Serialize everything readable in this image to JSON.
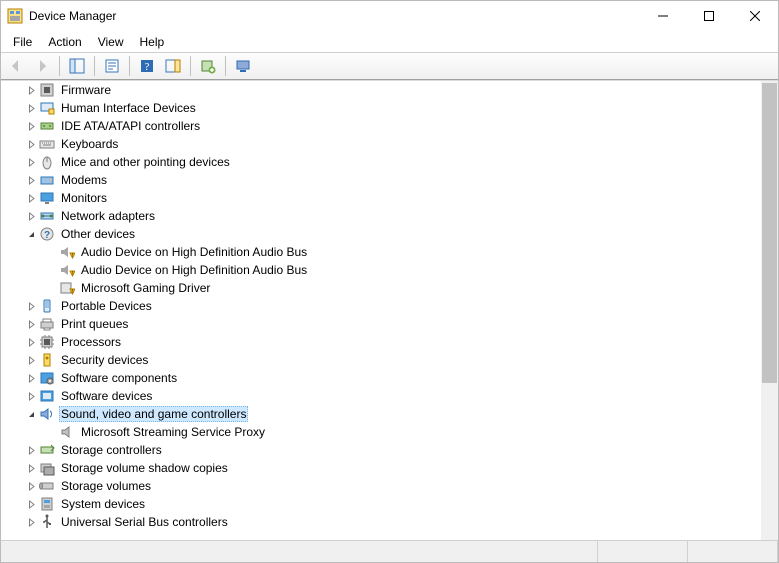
{
  "window": {
    "title": "Device Manager"
  },
  "menu": {
    "file": "File",
    "action": "Action",
    "view": "View",
    "help": "Help"
  },
  "tree": [
    {
      "label": "Firmware",
      "icon": "firmware",
      "expandable": true,
      "expanded": false,
      "children": []
    },
    {
      "label": "Human Interface Devices",
      "icon": "hid",
      "expandable": true,
      "expanded": false,
      "children": []
    },
    {
      "label": "IDE ATA/ATAPI controllers",
      "icon": "ide",
      "expandable": true,
      "expanded": false,
      "children": []
    },
    {
      "label": "Keyboards",
      "icon": "keyboard",
      "expandable": true,
      "expanded": false,
      "children": []
    },
    {
      "label": "Mice and other pointing devices",
      "icon": "mouse",
      "expandable": true,
      "expanded": false,
      "children": []
    },
    {
      "label": "Modems",
      "icon": "modem",
      "expandable": true,
      "expanded": false,
      "children": []
    },
    {
      "label": "Monitors",
      "icon": "monitor",
      "expandable": true,
      "expanded": false,
      "children": []
    },
    {
      "label": "Network adapters",
      "icon": "net",
      "expandable": true,
      "expanded": false,
      "children": []
    },
    {
      "label": "Other devices",
      "icon": "other",
      "expandable": true,
      "expanded": true,
      "children": [
        {
          "label": "Audio Device on High Definition Audio Bus",
          "icon": "audio-warn"
        },
        {
          "label": "Audio Device on High Definition Audio Bus",
          "icon": "audio-warn"
        },
        {
          "label": "Microsoft Gaming Driver",
          "icon": "generic-warn"
        }
      ]
    },
    {
      "label": "Portable Devices",
      "icon": "portable",
      "expandable": true,
      "expanded": false,
      "children": []
    },
    {
      "label": "Print queues",
      "icon": "printer",
      "expandable": true,
      "expanded": false,
      "children": []
    },
    {
      "label": "Processors",
      "icon": "cpu",
      "expandable": true,
      "expanded": false,
      "children": []
    },
    {
      "label": "Security devices",
      "icon": "security",
      "expandable": true,
      "expanded": false,
      "children": []
    },
    {
      "label": "Software components",
      "icon": "swcomp",
      "expandable": true,
      "expanded": false,
      "children": []
    },
    {
      "label": "Software devices",
      "icon": "swdev",
      "expandable": true,
      "expanded": false,
      "children": []
    },
    {
      "label": "Sound, video and game controllers",
      "icon": "sound",
      "expandable": true,
      "expanded": true,
      "selected": true,
      "children": [
        {
          "label": "Microsoft Streaming Service Proxy",
          "icon": "speaker"
        }
      ]
    },
    {
      "label": "Storage controllers",
      "icon": "storagectl",
      "expandable": true,
      "expanded": false,
      "children": []
    },
    {
      "label": "Storage volume shadow copies",
      "icon": "shadow",
      "expandable": true,
      "expanded": false,
      "children": []
    },
    {
      "label": "Storage volumes",
      "icon": "volume",
      "expandable": true,
      "expanded": false,
      "children": []
    },
    {
      "label": "System devices",
      "icon": "system",
      "expandable": true,
      "expanded": false,
      "children": []
    },
    {
      "label": "Universal Serial Bus controllers",
      "icon": "usb",
      "expandable": true,
      "expanded": false,
      "children": []
    }
  ]
}
